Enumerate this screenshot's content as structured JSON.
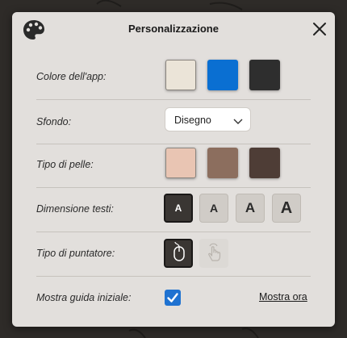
{
  "dialog": {
    "title": "Personalizzazione",
    "icons": {
      "header": "palette-icon",
      "close": "close-icon"
    }
  },
  "rows": {
    "app_color": {
      "label": "Colore dell'app:",
      "options": [
        "#ebe4d8",
        "#0a6fd2",
        "#2e2e2e"
      ],
      "selected_index": 0
    },
    "background": {
      "label": "Sfondo:",
      "selected_value": "Disegno"
    },
    "skin_tone": {
      "label": "Tipo di pelle:",
      "options": [
        "#e9c5b3",
        "#8c6e5e",
        "#4e3d36"
      ],
      "selected_index": 0
    },
    "text_size": {
      "label": "Dimensione testi:",
      "options": [
        "A",
        "A",
        "A",
        "A"
      ],
      "selected_index": 0
    },
    "pointer": {
      "label": "Tipo di puntatore:",
      "options": [
        "mouse-icon",
        "touch-hand-icon"
      ],
      "selected_index": 0
    },
    "initial_guide": {
      "label": "Mostra guida iniziale:",
      "checked": true,
      "link_label": "Mostra ora"
    }
  },
  "colors": {
    "accent": "#1f72d1",
    "dialog_bg": "#e2dfdc",
    "page_bg": "#2e2b28"
  }
}
